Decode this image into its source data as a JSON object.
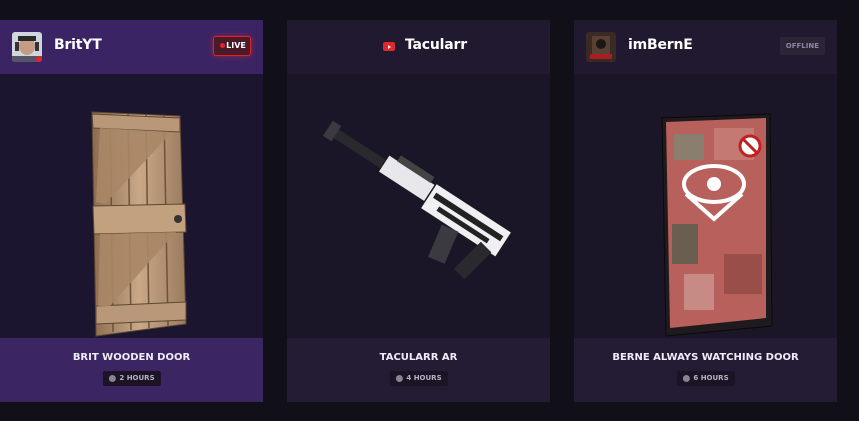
{
  "cards": [
    {
      "streamer": "BritYT",
      "status": "LIVE",
      "item": "BRIT WOODEN DOOR",
      "time": "2 HOURS"
    },
    {
      "streamer": "Tacularr",
      "status": "",
      "item": "TACULARR AR",
      "time": "4 HOURS"
    },
    {
      "streamer": "imBernE",
      "status": "OFFLINE",
      "item": "BERNE ALWAYS WATCHING DOOR",
      "time": "6 HOURS"
    }
  ],
  "colors": {
    "live": "#e0242c",
    "accent": "#3a2463",
    "youtube": "#e0282c"
  },
  "icons": [
    "avatar",
    "youtube-icon",
    "clock-icon"
  ]
}
